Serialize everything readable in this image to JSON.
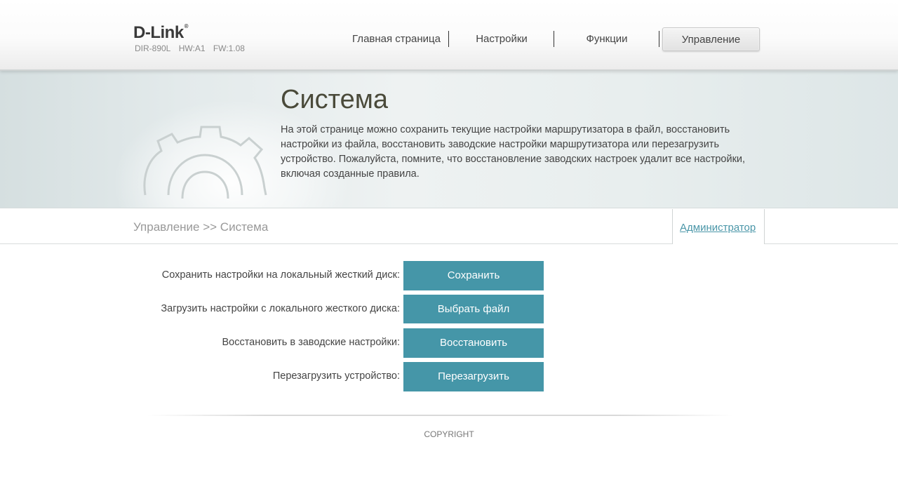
{
  "header": {
    "logo": "D-Link",
    "logo_reg": "®",
    "model": "DIR-890L",
    "hw": "HW:A1",
    "fw": "FW:1.08"
  },
  "nav": {
    "items": [
      {
        "label": "Главная страница",
        "active": false
      },
      {
        "label": "Настройки",
        "active": false
      },
      {
        "label": "Функции",
        "active": false
      },
      {
        "label": "Управление",
        "active": true
      }
    ]
  },
  "banner": {
    "title": "Система",
    "description": "На этой странице можно сохранить текущие настройки маршрутизатора в файл, восстановить настройки из файла, восстановить заводские настройки маршрутизатора или перезагрузить устройство. Пожалуйста, помните, что восстановление заводских настроек удалит все настройки, включая созданные правила.",
    "icon": "gear-icon"
  },
  "breadcrumb": "Управление >> Система",
  "admin_link": "Администратор",
  "rows": [
    {
      "label": "Сохранить настройки на локальный жесткий диск:",
      "button": "Сохранить"
    },
    {
      "label": "Загрузить настройки с локального жесткого диска:",
      "button": "Выбрать файл"
    },
    {
      "label": "Восстановить в заводские настройки:",
      "button": "Восстановить"
    },
    {
      "label": "Перезагрузить устройство:",
      "button": "Перезагрузить"
    }
  ],
  "footer": {
    "copyright": "COPYRIGHT"
  },
  "colors": {
    "accent": "#4596a8",
    "link": "#4a96a8",
    "title": "#4a4a3a"
  }
}
